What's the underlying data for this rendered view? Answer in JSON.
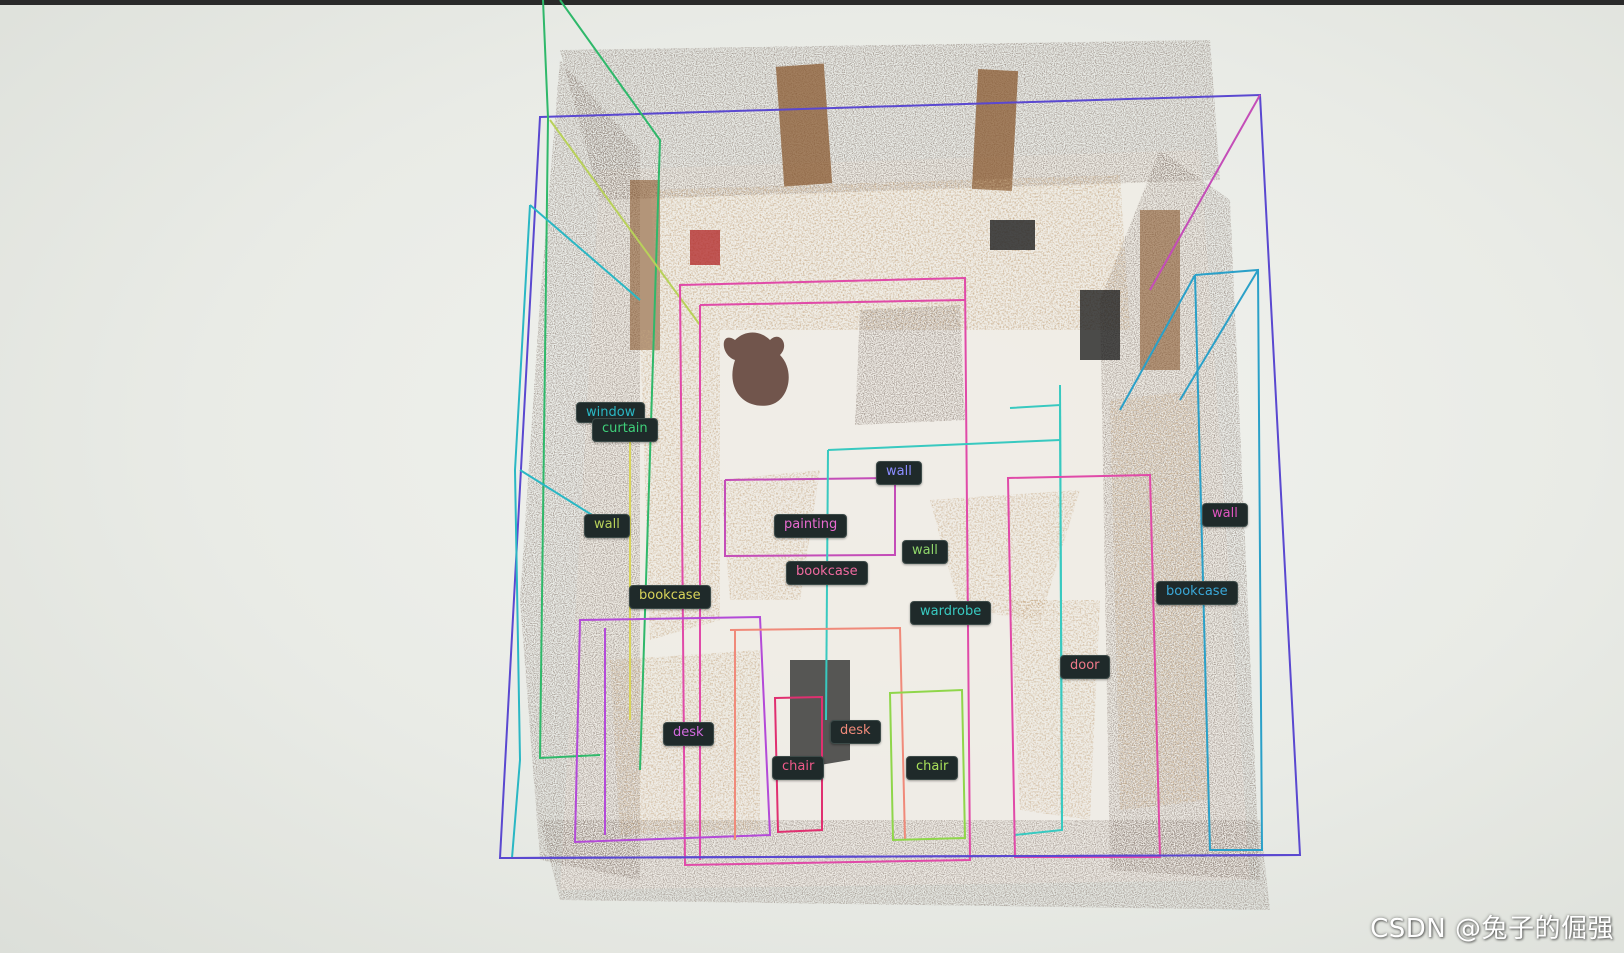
{
  "labels": {
    "window": "window",
    "curtain": "curtain",
    "wall_left": "wall",
    "wall_top": "wall",
    "wall_mid": "wall",
    "wall_right": "wall",
    "painting": "painting",
    "bookcase_center": "bookcase",
    "bookcase_left": "bookcase",
    "bookcase_right": "bookcase",
    "wardrobe": "wardrobe",
    "door": "door",
    "desk_left": "desk",
    "desk_center": "desk",
    "chair_left": "chair",
    "chair_right": "chair"
  },
  "watermark": "CSDN @兔子的倔强",
  "colors": {
    "window": "#2ab7c4",
    "curtain": "#3fd07a",
    "wall_left": "#b8d15a",
    "wall_top": "#6b6cf0",
    "wall_mid": "#8fd66a",
    "wall_right": "#e055c0",
    "painting": "#e86bd0",
    "bookcase_center": "#f06aa0",
    "bookcase_left": "#d8d45a",
    "bookcase_right": "#3aa8d8",
    "wardrobe": "#38c9c0",
    "door": "#f07a8a",
    "desk_left": "#d36adf",
    "desk_center": "#f08a7a",
    "chair_left": "#f05a8a",
    "chair_right": "#a8e05a"
  }
}
